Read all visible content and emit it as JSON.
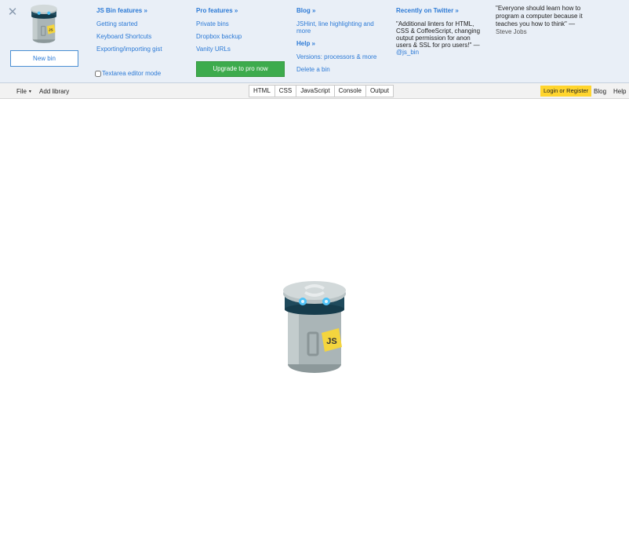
{
  "panel": {
    "close_icon": "close-icon",
    "new_bin_label": "New bin",
    "columns": {
      "jsbin": {
        "heading": "JS Bin features »",
        "links": [
          "Getting started",
          "Keyboard Shortcuts",
          "Exporting/importing gist"
        ]
      },
      "pro": {
        "heading": "Pro features »",
        "links": [
          "Private bins",
          "Dropbox backup",
          "Vanity URLs"
        ]
      },
      "blog": {
        "heading": "Blog »",
        "links": [
          "JSHint, line highlighting and more"
        ],
        "help_heading": "Help »",
        "help_links": [
          "Versions: processors & more",
          "Delete a bin"
        ]
      },
      "twitter": {
        "heading": "Recently on Twitter »",
        "tweet": "\"Additional linters for HTML, CSS & CoffeeScript, changing output permission for anon users & SSL for pro users!\" —",
        "handle": "@js_bin"
      },
      "quote": {
        "text": "\"Everyone should learn how to program a computer because it teaches you how to think\" —",
        "author": "Steve Jobs"
      }
    },
    "textarea_mode_label": "Textarea editor mode",
    "upgrade_label": "Upgrade to pro now"
  },
  "toolbar": {
    "file_label": "File",
    "add_library_label": "Add library",
    "tabs": [
      "HTML",
      "CSS",
      "JavaScript",
      "Console",
      "Output"
    ],
    "login_label": "Login or Register",
    "blog_label": "Blog",
    "help_label": "Help"
  },
  "colors": {
    "accent": "#2c7ad6",
    "panel_bg": "#e9eff7",
    "upgrade": "#3dab4d",
    "login": "#ffd52e"
  },
  "logo": {
    "badge_text": "JS",
    "icon": "jsbin-bin-logo"
  }
}
